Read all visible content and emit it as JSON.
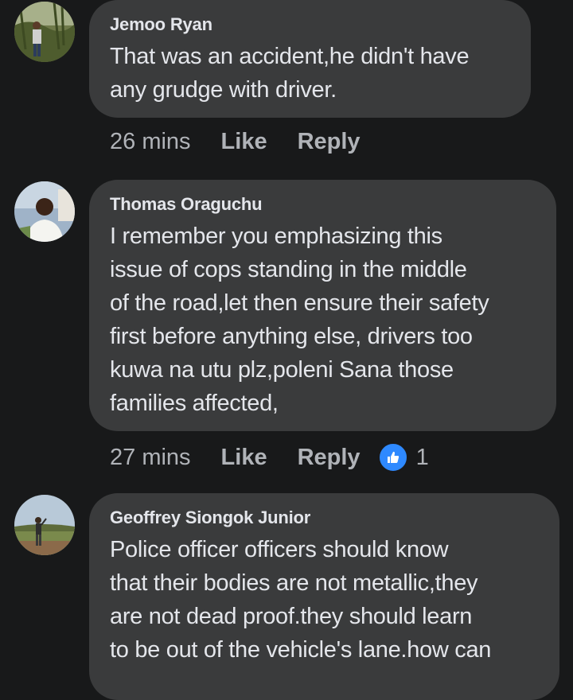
{
  "comments": [
    {
      "author": "Jemoo Ryan",
      "text": "That was an accident,he didn't have\nany grudge with driver.",
      "time": "26 mins",
      "like_label": "Like",
      "reply_label": "Reply"
    },
    {
      "author": "Thomas Oraguchu",
      "text": "I remember you emphasizing this\nissue of cops standing in the middle\nof the road,let then ensure their safety\nfirst before anything else, drivers too\nkuwa na utu plz,poleni Sana those\nfamilies affected,",
      "time": "27 mins",
      "like_label": "Like",
      "reply_label": "Reply",
      "reaction_count": "1",
      "reaction_icon": "thumbs-up-icon"
    },
    {
      "author": "Geoffrey Siongok Junior",
      "text": "Police officer officers should know\nthat their bodies are not metallic,they\nare not dead proof.they should learn\nto be out of the vehicle's lane.how can"
    }
  ],
  "colors": {
    "background": "#18191a",
    "bubble": "#3a3b3c",
    "text": "#e4e6eb",
    "secondary_text": "#b0b3b8",
    "like_blue": "#2e89ff"
  }
}
